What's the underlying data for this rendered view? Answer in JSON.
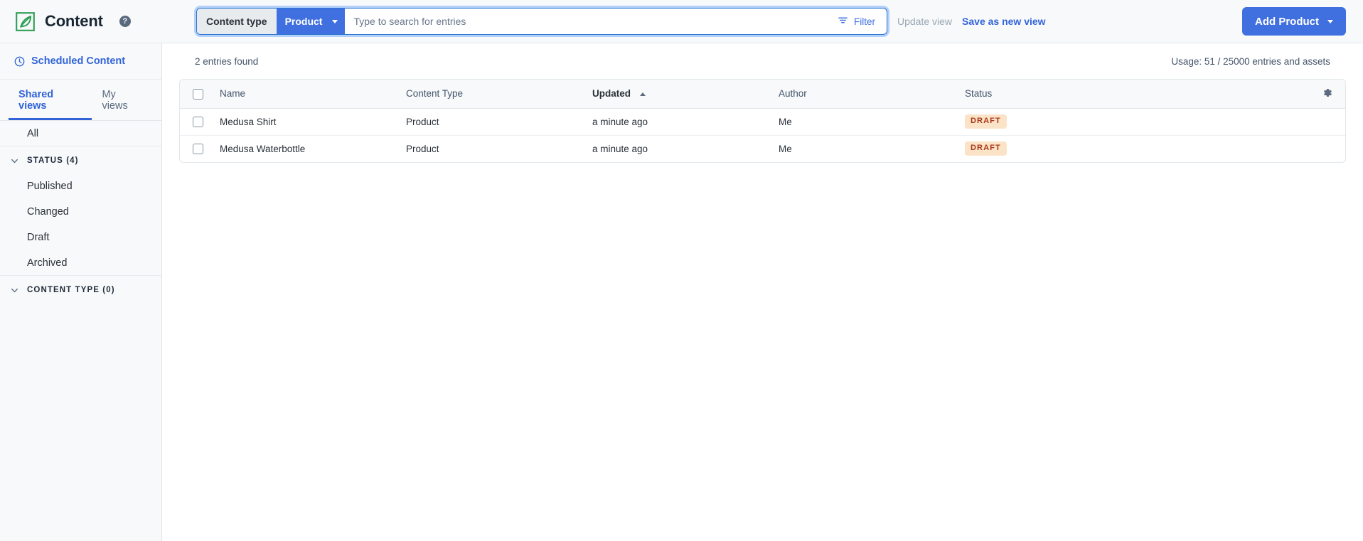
{
  "header": {
    "logo_icon": "contentful-leaf-logo",
    "title": "Content",
    "help_icon": "question-mark-help-icon",
    "search": {
      "content_type_label": "Content type",
      "content_type_value": "Product",
      "placeholder": "Type to search for entries",
      "value": "",
      "filter_label": "Filter",
      "filter_icon": "filter-funnel-icon"
    },
    "update_view_label": "Update view",
    "save_as_new_view_label": "Save as new view",
    "add_button_label": "Add Product",
    "add_button_caret_icon": "chevron-down-icon"
  },
  "sidebar": {
    "scheduled_content": {
      "label": "Scheduled Content",
      "icon": "clock-icon"
    },
    "tabs": [
      {
        "label": "Shared views",
        "active": true
      },
      {
        "label": "My views",
        "active": false
      }
    ],
    "all_label": "All",
    "groups": [
      {
        "label": "STATUS (4)",
        "icon": "chevron-down-icon",
        "items": [
          "Published",
          "Changed",
          "Draft",
          "Archived"
        ]
      },
      {
        "label": "CONTENT TYPE (0)",
        "icon": "chevron-down-icon",
        "items": []
      }
    ]
  },
  "main": {
    "entries_found": "2 entries found",
    "usage": "Usage: 51 / 25000 entries and assets",
    "table": {
      "select_all_icon": "checkbox-unchecked-icon",
      "settings_icon": "gear-icon",
      "sort_icon": "sort-ascending-caret-icon",
      "columns": [
        "Name",
        "Content Type",
        "Updated",
        "Author",
        "Status"
      ],
      "sorted_column": "Updated",
      "sort_direction": "asc",
      "rows": [
        {
          "name": "Medusa Shirt",
          "content_type": "Product",
          "updated": "a minute ago",
          "author": "Me",
          "status": "DRAFT"
        },
        {
          "name": "Medusa Waterbottle",
          "content_type": "Product",
          "updated": "a minute ago",
          "author": "Me",
          "status": "DRAFT"
        }
      ]
    }
  },
  "colors": {
    "accent_blue": "#4070e0",
    "link_blue": "#3264d8",
    "logo_green": "#2e9e55",
    "badge_bg": "#fbe3c7",
    "badge_text": "#a8361a",
    "sidebar_bg": "#f7f9fa",
    "border": "#e1e7ea"
  }
}
